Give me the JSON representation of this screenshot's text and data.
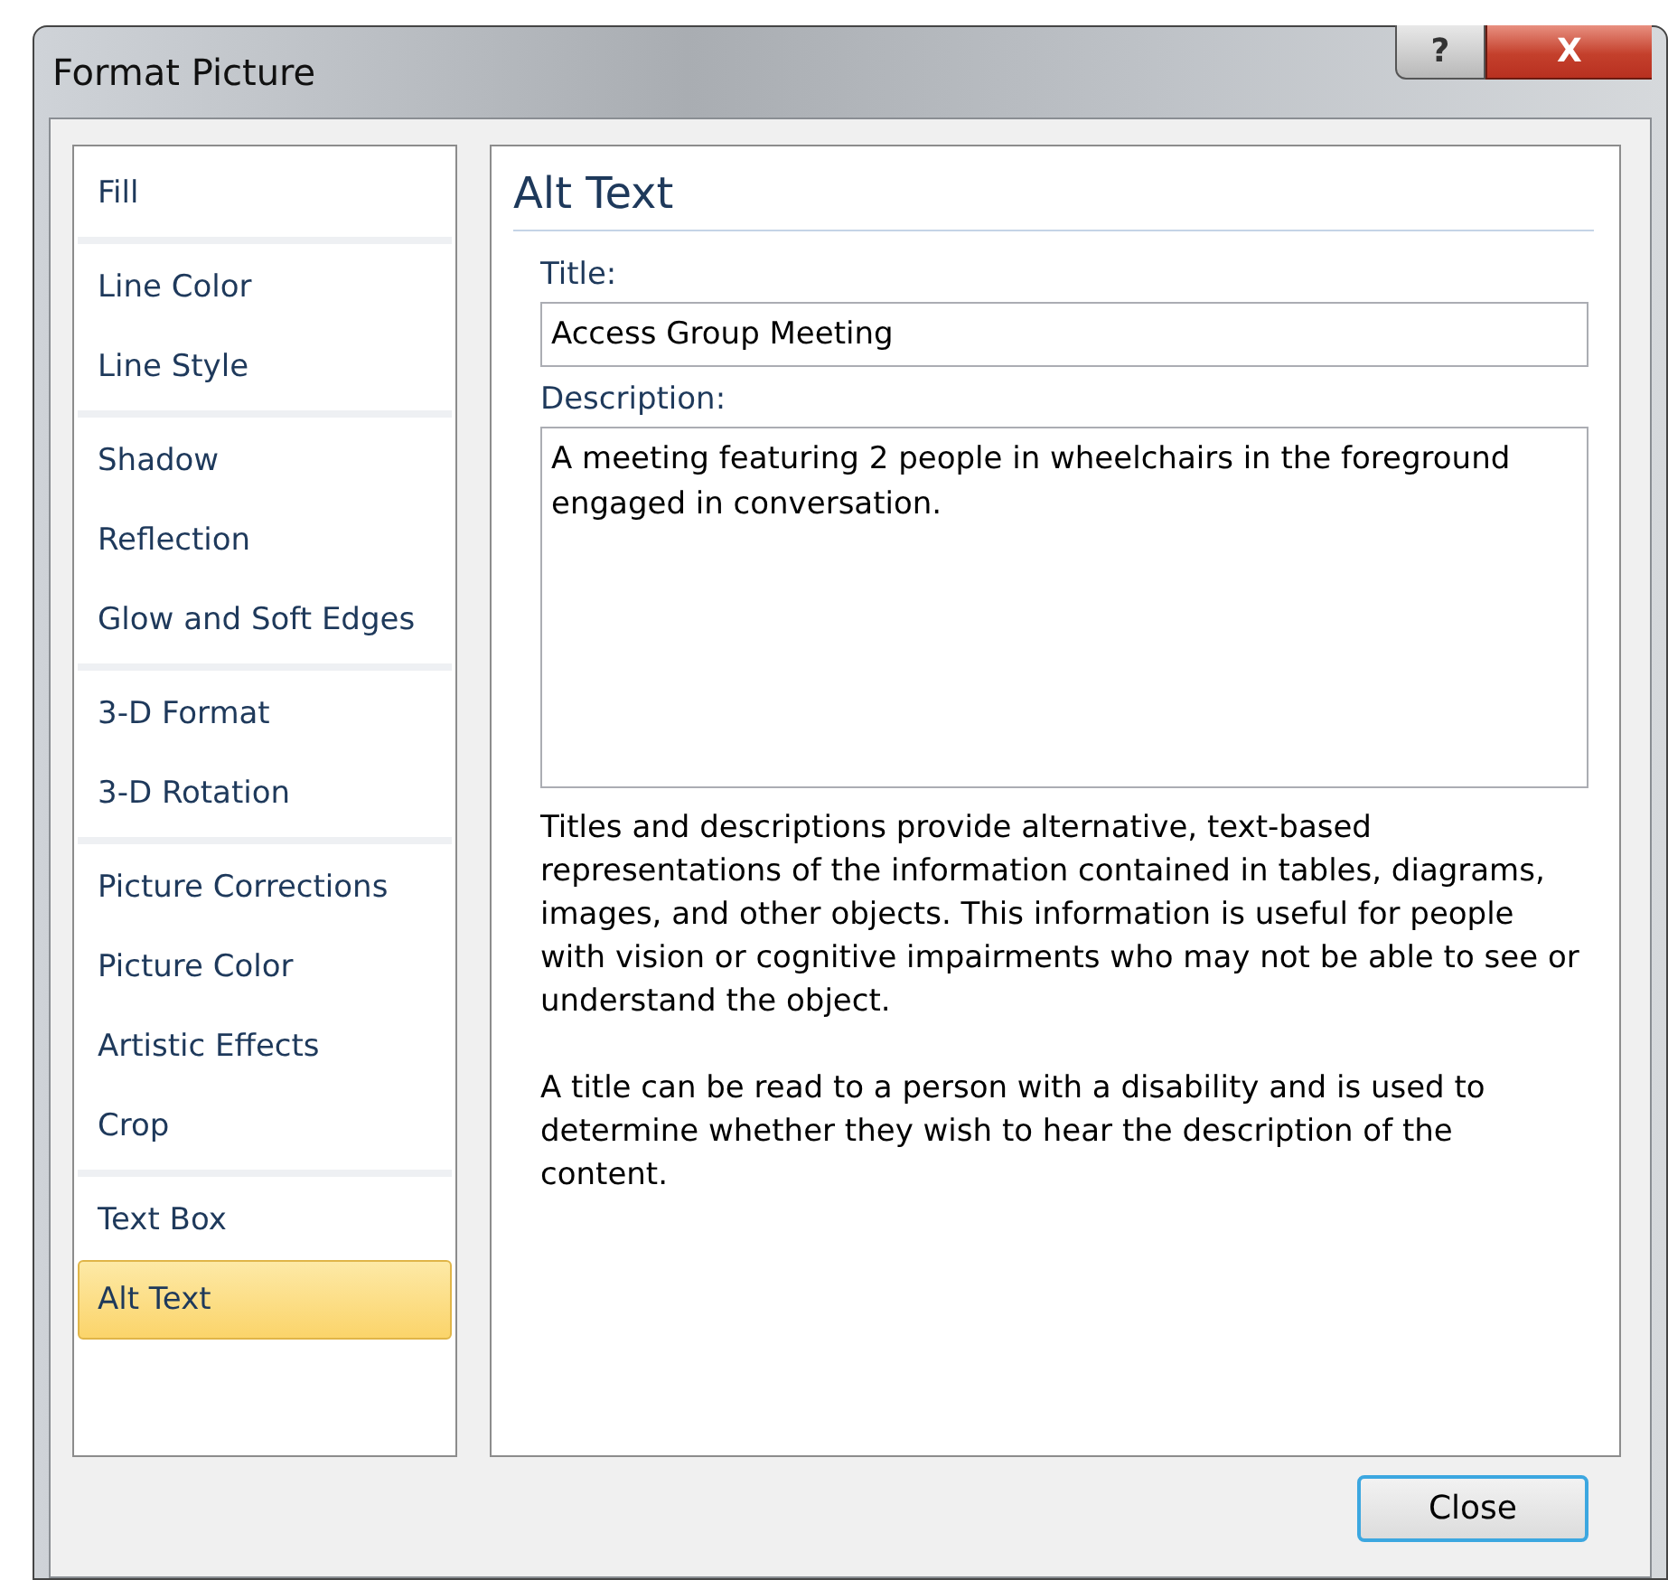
{
  "window": {
    "title": "Format Picture",
    "help_button": "?",
    "close_button": "X"
  },
  "sidebar": {
    "groups": [
      [
        {
          "label": "Fill",
          "selected": false
        }
      ],
      [
        {
          "label": "Line Color",
          "selected": false
        },
        {
          "label": "Line Style",
          "selected": false
        }
      ],
      [
        {
          "label": "Shadow",
          "selected": false
        },
        {
          "label": "Reflection",
          "selected": false
        },
        {
          "label": "Glow and Soft Edges",
          "selected": false
        }
      ],
      [
        {
          "label": "3-D Format",
          "selected": false
        },
        {
          "label": "3-D Rotation",
          "selected": false
        }
      ],
      [
        {
          "label": "Picture Corrections",
          "selected": false
        },
        {
          "label": "Picture Color",
          "selected": false
        },
        {
          "label": "Artistic Effects",
          "selected": false
        },
        {
          "label": "Crop",
          "selected": false
        }
      ],
      [
        {
          "label": "Text Box",
          "selected": false
        },
        {
          "label": "Alt Text",
          "selected": true
        }
      ]
    ]
  },
  "panel": {
    "heading": "Alt Text",
    "title_label": "Title:",
    "title_value": "Access Group Meeting",
    "description_label": "Description:",
    "description_value": "A meeting featuring 2 people in wheelchairs in the foreground engaged in conversation.",
    "help_paragraphs": [
      "Titles and descriptions provide alternative, text-based representations of the information contained in tables, diagrams, images, and other objects. This information is useful for people with vision or cognitive impairments who may not be able to see or understand the object.",
      "A title can be read to a person with a disability and is used to determine whether they wish to hear the description of the content."
    ]
  },
  "footer": {
    "close": "Close"
  }
}
